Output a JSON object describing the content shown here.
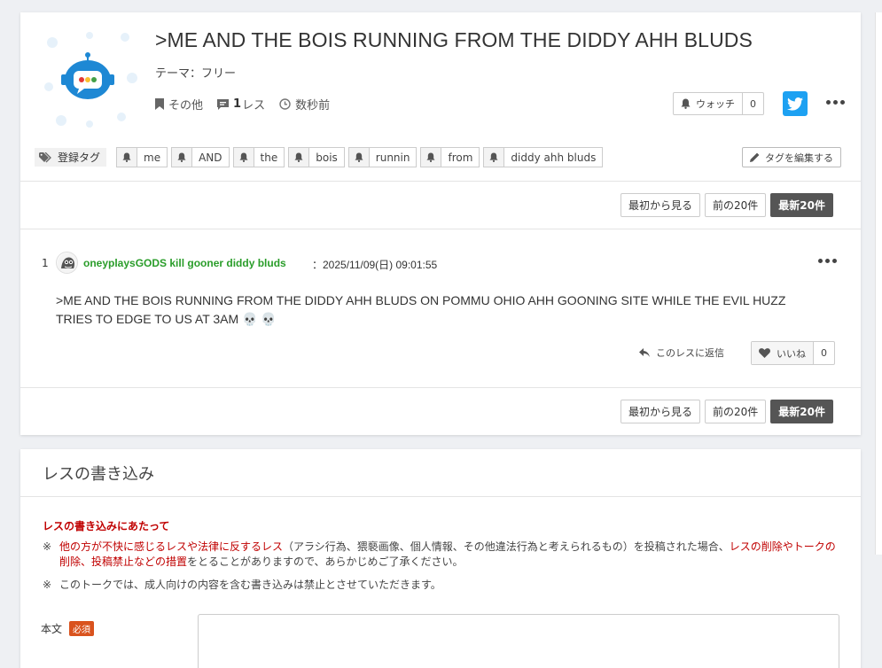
{
  "topic": {
    "title": ">ME AND THE BOIS RUNNING FROM THE DIDDY AHH BLUDS",
    "theme": "テーマ：フリー",
    "category": "その他",
    "res_count": "1",
    "res_suffix": "レス",
    "time": "数秒前",
    "watch_label": "ウォッチ",
    "watch_count": "0",
    "tags_label": "登録タグ",
    "tags": [
      "me",
      "AND",
      "the",
      "bois",
      "runnin",
      "from",
      "diddy ahh bluds"
    ],
    "edit_tags_label": "タグを編集する"
  },
  "pager": {
    "first": "最初から見る",
    "prev": "前の20件",
    "latest": "最新20件"
  },
  "post": {
    "number": "1",
    "username": "oneyplaysGODS kill gooner diddy bluds",
    "date": "：2025/11/09(日) 09:01:55",
    "body_line1": ">ME AND THE BOIS RUNNING FROM THE DIDDY AHH BLUDS ON POMMU OHIO AHH GOONING SITE WHILE THE EVIL HUZZ",
    "body_line2": "TRIES TO EDGE TO US AT 3AM 💀 💀",
    "reply_label": "このレスに返信",
    "like_label": "いいね",
    "like_count": "0"
  },
  "form": {
    "title": "レスの書き込み",
    "notice_title": "レスの書き込みにあたって",
    "notice1_mark": "※",
    "notice1_red_a": "他の方が不快に感じるレスや法律に反するレス",
    "notice1_mid": "（アラシ行為、猥褻画像、個人情報、その他違法行為と考えられるもの）を投稿された場合、",
    "notice1_red_b": "レスの削除やトークの削除、投稿禁止などの措置",
    "notice1_end": "をとることがありますので、あらかじめご了承ください。",
    "notice2_mark": "※",
    "notice2": "このトークでは、成人向けの内容を含む書き込みは禁止とさせていただきます。",
    "body_label": "本文",
    "required": "必須"
  },
  "colors": {
    "twitter": "#1da1f2",
    "username": "#2a9d2a",
    "notice_red": "#c00000",
    "required_badge": "#d9531e",
    "active_pager": "#555555"
  }
}
